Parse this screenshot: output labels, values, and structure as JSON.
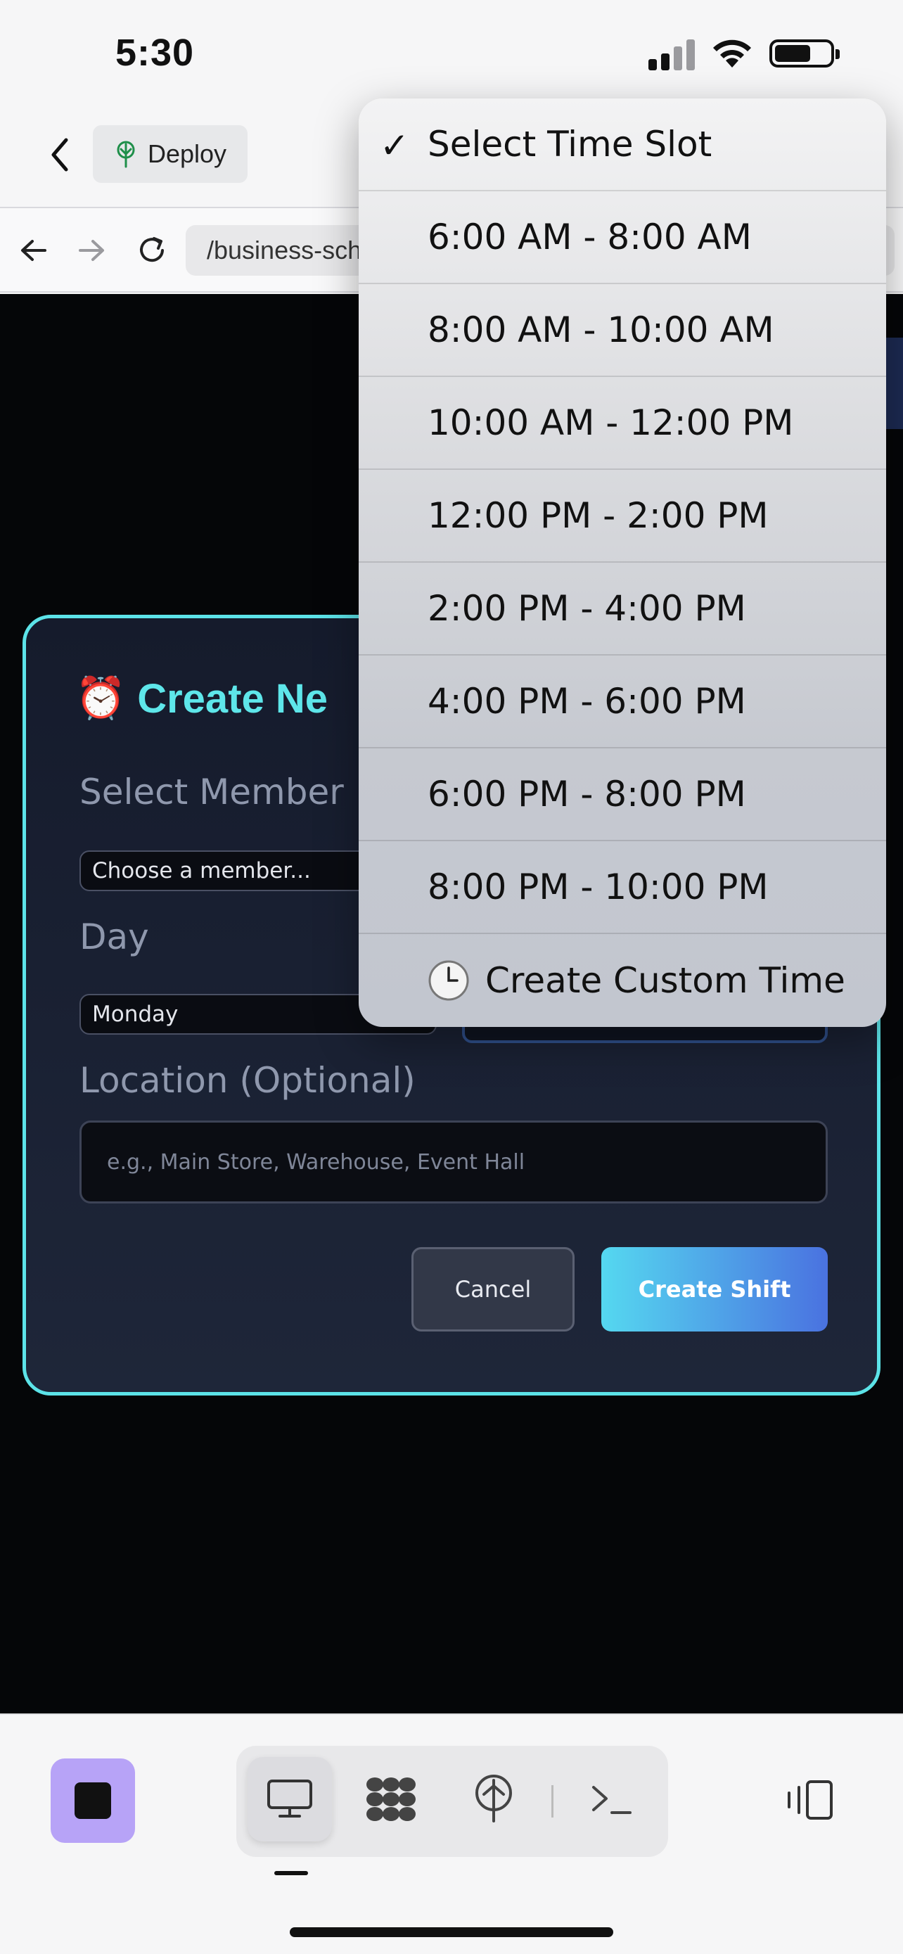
{
  "status_bar": {
    "time": "5:30"
  },
  "app_bar": {
    "deploy_label": "Deploy"
  },
  "browser": {
    "url": "/business-sch"
  },
  "modal": {
    "title": "Create Ne",
    "title_icon": "⏰",
    "member_label": "Select Member",
    "member_value": "Choose a member...",
    "day_label": "Day",
    "day_value": "Monday",
    "location_label": "Location (Optional)",
    "location_placeholder": "e.g., Main Store, Warehouse, Event Hall",
    "cancel_label": "Cancel",
    "create_label": "Create Shift"
  },
  "dropdown": {
    "selected": "Select Time Slot",
    "items": [
      "Select Time Slot",
      "6:00 AM - 8:00 AM",
      "8:00 AM - 10:00 AM",
      "10:00 AM - 12:00 PM",
      "12:00 PM - 2:00 PM",
      "2:00 PM - 4:00 PM",
      "4:00 PM - 6:00 PM",
      "6:00 PM - 8:00 PM",
      "8:00 PM - 10:00 PM",
      "Create Custom Time"
    ],
    "custom_icon": "clock-icon"
  },
  "colors": {
    "accent_cyan": "#5ee6ea",
    "modal_border": "#5ce3e8",
    "create_gradient_start": "#55d8f0",
    "create_gradient_end": "#4a72e0",
    "stop_button": "#b7a3f7"
  },
  "toolbar": {
    "icons": [
      "stop-icon",
      "desktop-icon",
      "apps-icon",
      "network-icon",
      "terminal-icon",
      "split-view-icon"
    ]
  }
}
